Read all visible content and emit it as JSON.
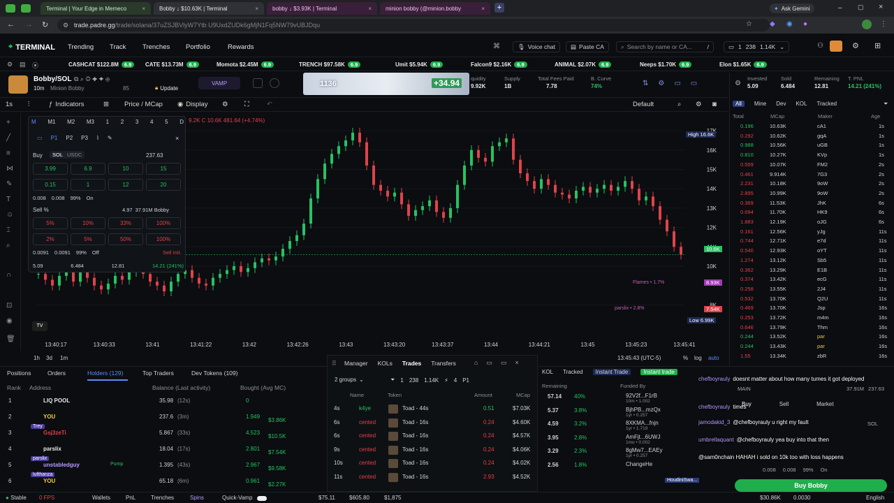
{
  "browser": {
    "tabs": [
      {
        "title": "Terminal | Your Edge in Memeco",
        "active": false
      },
      {
        "title": "Bobby ↓ $10.63K | Terminal",
        "active": true
      },
      {
        "title": "bobby ↓ $3.93K | Terminal",
        "active": false
      },
      {
        "title": "minion bobby (@minion.bobby",
        "active": false
      }
    ],
    "gemini": "Ask Gemini",
    "url_host": "trade.padre.gg",
    "url_path": "/trade/solana/37uZSJBVlyW7Ytb U9UxdZUDk6gMjN1Fq5NW79vUBJDqu"
  },
  "nav": {
    "logo": "TERMINAL",
    "links": [
      "Trending",
      "Track",
      "Trenches",
      "Portfolio",
      "Rewards"
    ],
    "voice_chat": "Voice chat",
    "paste_ca": "Paste CA",
    "search_placeholder": "Search by name or CA...",
    "search_shortcut": "/",
    "wallet_count": "1",
    "wallet_a": "238",
    "wallet_b": "1.14K"
  },
  "ticker": [
    {
      "name": "CASHCAT",
      "mc": "$122.8M",
      "pct": "6.9"
    },
    {
      "name": "CATE",
      "mc": "$13.73M",
      "pct": "6.9"
    },
    {
      "name": "Momota",
      "mc": "$2.45M",
      "pct": "6.9"
    },
    {
      "name": "TRENCH",
      "mc": "$97.58K",
      "pct": "6.9"
    },
    {
      "name": "Umit",
      "mc": "$5.94K",
      "pct": "6.9"
    },
    {
      "name": "Falcon9",
      "mc": "$2.16K",
      "pct": "6.9"
    },
    {
      "name": "ANIMAL",
      "mc": "$2.07K",
      "pct": "6.9"
    },
    {
      "name": "Neeps",
      "mc": "$1.70K",
      "pct": "6.9"
    },
    {
      "name": "Elon",
      "mc": "$1.65K",
      "pct": "6.9"
    }
  ],
  "token": {
    "pair": "Bobby/SOL",
    "name": "Minion Bobby",
    "age": "10m",
    "holders": "85",
    "update": "Update",
    "vamp": "VAMP",
    "banner_num": "1136",
    "banner_pnl": "+34.94",
    "liquidity_label": "quidity",
    "liquidity": "9.92K",
    "supply_label": "Supply",
    "supply": "1B",
    "fees_label": "Total Fees Paid",
    "fees": "7.78",
    "curve_label": "B. Curve",
    "curve": "74%"
  },
  "pnl": {
    "invested_label": "Invested",
    "invested": "5.09",
    "sold_label": "Sold",
    "sold": "6.484",
    "remaining_label": "Remaining",
    "remaining": "12.81",
    "tpnl_label": "T. PNL",
    "tpnl": "14.21 (241%)"
  },
  "chart_toolbar": {
    "interval": "1s",
    "indicators": "Indicators",
    "price_mcap": "Price / MCap",
    "display": "Display",
    "default": "Default"
  },
  "chart_data": {
    "type": "candlestick",
    "ohlc_text": "9.2K C 10.6K 481.64 (+4.74%)",
    "y_ticks": [
      "17K",
      "16K",
      "15K",
      "14K",
      "13K",
      "12K",
      "11K",
      "10K",
      "8K"
    ],
    "x_ticks": [
      "13:40:17",
      "13:40:33",
      "13:41",
      "13:41:22",
      "13:42",
      "13:42:26",
      "13:43",
      "13:43:20",
      "13:43:37",
      "13:44",
      "13:44:21",
      "13:45",
      "13:45:23",
      "13:45:41"
    ],
    "high_label": "High",
    "high": "16.6K",
    "current": "10.6K",
    "flag_a": "8.93K",
    "flag_b": "7.54K",
    "low_label": "Low",
    "low": "6.99K",
    "annot_a": "Flames • 1.7%",
    "annot_b": "parslix • 2.8%",
    "time_utc": "13:45:43 (UTC-5)",
    "scale_pct": "%",
    "scale_log": "log",
    "scale_auto": "auto",
    "ranges": [
      "1h",
      "3d",
      "1m"
    ],
    "series": [
      {
        "name": "mcap_k",
        "values": [
          9.6,
          9.3,
          9.0,
          9.5,
          9.7,
          9.2,
          9.8,
          9.4,
          9.0,
          8.8,
          9.1,
          9.5,
          9.3,
          9.7,
          9.9,
          9.6,
          9.2,
          9.0,
          8.7,
          9.2,
          9.6,
          9.8,
          9.4,
          9.1,
          9.0,
          9.4,
          9.6,
          9.8,
          10.0,
          9.7,
          9.9,
          10.2,
          10.4,
          10.3,
          10.5,
          10.9,
          11.3,
          11.6,
          12.2,
          13.5,
          14.5,
          15.3,
          15.8,
          16.2,
          16.5,
          16.9,
          16.4,
          15.2,
          14.2,
          13.9,
          13.6,
          13.8,
          13.2,
          12.6,
          12.9,
          13.1,
          13.4,
          12.8,
          12.5,
          13.0,
          14.2,
          15.2,
          16.0,
          15.6,
          15.4,
          16.2,
          16.4,
          16.6,
          15.5,
          14.8,
          14.4,
          14.0,
          14.5,
          14.2,
          13.8,
          13.7,
          13.5,
          13.9,
          14.1,
          13.8,
          14.0,
          14.2,
          13.9,
          14.1,
          14.4,
          14.0,
          13.4,
          13.6,
          13.1,
          12.4,
          11.8,
          11.0,
          10.6
        ]
      }
    ]
  },
  "buy_panel": {
    "presets": [
      "M",
      "M1",
      "M2",
      "M3",
      "1",
      "2",
      "3",
      "4",
      "5",
      "D"
    ],
    "tabs": [
      "P1",
      "P2",
      "P3"
    ],
    "buy_label": "Buy",
    "currency_sol": "SOL",
    "currency_usdc": "USDC",
    "balance": "237.63",
    "amounts_row1": [
      "3.99",
      "6.9",
      "10",
      "15"
    ],
    "amounts_row2": [
      "0.15",
      "1",
      "12",
      "20"
    ],
    "buy_fee1": "0.008",
    "buy_fee2": "0.008",
    "buy_slip": "99%",
    "buy_mev": "On",
    "sell_label": "Sell %",
    "sell_bal": "4.97",
    "sell_bal2": "37.91M Bobby",
    "sell_row1": [
      "5%",
      "10%",
      "33%",
      "100%"
    ],
    "sell_row2": [
      "2%",
      "5%",
      "50%",
      "100%"
    ],
    "sell_fee1": "0.0091",
    "sell_fee2": "0.0091",
    "sell_slip": "99%",
    "sell_mev": "Off",
    "sell_init": "Sell Init.",
    "foot": [
      "5.09",
      "6.484",
      "12.81",
      "14.21 (241%)"
    ]
  },
  "trades_panel": {
    "filters": [
      "All",
      "Mine",
      "Dev",
      "KOL",
      "Tracked"
    ],
    "headers": [
      "Total",
      "MCap",
      "Maker",
      "Age"
    ],
    "rows": [
      {
        "total": "0.196",
        "mc": "10.63K",
        "maker": "cA1",
        "age": "1s",
        "side": "buy"
      },
      {
        "total": "0.292",
        "mc": "10.62K",
        "maker": "gqA",
        "age": "1s",
        "side": "sell"
      },
      {
        "total": "0.988",
        "mc": "10.56K",
        "maker": "uGB",
        "age": "1s",
        "side": "buy"
      },
      {
        "total": "0.810",
        "mc": "10.27K",
        "maker": "KVp",
        "age": "1s",
        "side": "buy"
      },
      {
        "total": "0.559",
        "mc": "10.07K",
        "maker": "FM2",
        "age": "2s",
        "side": "sell"
      },
      {
        "total": "0.461",
        "mc": "9.914K",
        "maker": "7G3",
        "age": "2s",
        "side": "sell"
      },
      {
        "total": "2.231",
        "mc": "10.18K",
        "maker": "9oW",
        "age": "2s",
        "side": "sell"
      },
      {
        "total": "2.895",
        "mc": "10.99K",
        "maker": "9oW",
        "age": "2s",
        "side": "sell"
      },
      {
        "total": "0.369",
        "mc": "11.53K",
        "maker": "JhK",
        "age": "6s",
        "side": "sell"
      },
      {
        "total": "0.694",
        "mc": "11.70K",
        "maker": "HK9",
        "age": "6s",
        "side": "sell"
      },
      {
        "total": "1.883",
        "mc": "12.19K",
        "maker": "oJG",
        "age": "6s",
        "side": "sell"
      },
      {
        "total": "0.161",
        "mc": "12.56K",
        "maker": "yJg",
        "age": "11s",
        "side": "sell"
      },
      {
        "total": "0.744",
        "mc": "12.71K",
        "maker": "e7d",
        "age": "11s",
        "side": "sell"
      },
      {
        "total": "0.540",
        "mc": "12.93K",
        "maker": "oYT",
        "age": "11s",
        "side": "sell"
      },
      {
        "total": "1.274",
        "mc": "13.12K",
        "maker": "Sb5",
        "age": "11s",
        "side": "sell"
      },
      {
        "total": "0.362",
        "mc": "13.29K",
        "maker": "E1B",
        "age": "11s",
        "side": "sell"
      },
      {
        "total": "0.374",
        "mc": "13.42K",
        "maker": "ecG",
        "age": "11s",
        "side": "sell"
      },
      {
        "total": "0.258",
        "mc": "13.55K",
        "maker": "2J4",
        "age": "11s",
        "side": "sell"
      },
      {
        "total": "0.532",
        "mc": "13.70K",
        "maker": "Q2U",
        "age": "11s",
        "side": "sell"
      },
      {
        "total": "0.469",
        "mc": "13.70K",
        "maker": "Jsp",
        "age": "16s",
        "side": "sell"
      },
      {
        "total": "0.253",
        "mc": "13.72K",
        "maker": "m4m",
        "age": "16s",
        "side": "sell"
      },
      {
        "total": "0.646",
        "mc": "13.79K",
        "maker": "Thm",
        "age": "16s",
        "side": "sell"
      },
      {
        "total": "0.244",
        "mc": "13.52K",
        "maker": "par",
        "age": "16s",
        "side": "buy"
      },
      {
        "total": "0.244",
        "mc": "13.43K",
        "maker": "par",
        "age": "16s",
        "side": "buy"
      },
      {
        "total": "1.55",
        "mc": "13.34K",
        "maker": "zbR",
        "age": "16s",
        "side": "sell"
      }
    ]
  },
  "bottom_tabs": [
    "Positions",
    "Orders",
    "Holders (129)",
    "Top Traders",
    "Dev Tokens (109)"
  ],
  "holders": {
    "headers": [
      "Rank",
      "Address",
      "Balance (Last activity)",
      "Bought (Avg MC)"
    ],
    "rows": [
      {
        "rank": "1",
        "addr": "LIQ POOL",
        "bal": "35.98",
        "act": "(12s)",
        "bought": "0",
        "bought_mc": ""
      },
      {
        "rank": "2",
        "addr": "YOU",
        "bal": "237.6",
        "act": "(3m)",
        "bought": "1.949",
        "bought_mc": "$3.86K"
      },
      {
        "rank": "3",
        "addr": "Gsj3zeTi",
        "bal": "5.867",
        "act": "(33s)",
        "bought": "4.523",
        "bought_mc": "$10.5K"
      },
      {
        "rank": "4",
        "addr": "parslix",
        "bal": "18.04",
        "act": "(17s)",
        "bought": "2.801",
        "bought_mc": "$7.54K"
      },
      {
        "rank": "5",
        "addr": "unstabledguy",
        "bal": "1.395",
        "act": "(43s)",
        "bought": "2.967",
        "bought_mc": "$9.58K"
      },
      {
        "rank": "6",
        "addr": "YOU",
        "bal": "65.18",
        "act": "(6m)",
        "bought": "0.961",
        "bought_mc": "$2.27K"
      }
    ],
    "tags": [
      "Trey",
      "parslix",
      "lufthanza"
    ],
    "pump_tag": "Pump"
  },
  "mid_panel": {
    "tabs": [
      "Manager",
      "KOLs",
      "Trades",
      "Transfers"
    ],
    "groups": "2 groups",
    "wallets": "1",
    "w_a": "238",
    "w_b": "1.14K",
    "w_c": "4",
    "preset": "P1",
    "headers": [
      "Name",
      "Token",
      "Amount",
      "MCap"
    ],
    "rows": [
      {
        "age": "4s",
        "name": "k4ye",
        "token": "Toad - 44s",
        "amt": "0.51",
        "mc": "$7.03K",
        "side": "buy"
      },
      {
        "age": "6s",
        "name": "cented",
        "token": "Toad - 16s",
        "amt": "0.24",
        "mc": "$4.60K",
        "side": "sell"
      },
      {
        "age": "6s",
        "name": "cented",
        "token": "Toad - 16s",
        "amt": "0.24",
        "mc": "$4.57K",
        "side": "sell"
      },
      {
        "age": "9s",
        "name": "cented",
        "token": "Toad - 16s",
        "amt": "0.24",
        "mc": "$4.06K",
        "side": "sell"
      },
      {
        "age": "10s",
        "name": "cented",
        "token": "Toad - 16s",
        "amt": "0.24",
        "mc": "$4.02K",
        "side": "sell"
      },
      {
        "age": "11s",
        "name": "cented",
        "token": "Toad - 16s",
        "amt": "2.93",
        "mc": "$4.52K",
        "side": "sell"
      }
    ]
  },
  "remaining_panel": {
    "tabs": [
      "KOL",
      "Tracked",
      "Instant Trade",
      "Instant trade"
    ],
    "headers": [
      "Remaining",
      "Funded By"
    ],
    "rows": [
      {
        "rem": "57.14",
        "pct": "40%",
        "fund": "92V2f...F1rB",
        "sub": "10m • 1.002"
      },
      {
        "rem": "5.37",
        "pct": "3.8%",
        "fund": "BjhPB...mzQx",
        "sub": "1yr • 0.257"
      },
      {
        "rem": "4.59",
        "pct": "3.2%",
        "fund": "8XKMA...fnjn",
        "sub": "1yr • 1.719"
      },
      {
        "rem": "3.95",
        "pct": "2.8%",
        "fund": "AmFjt...6UWJ",
        "sub": "1mo • 0.002"
      },
      {
        "rem": "3.29",
        "pct": "2.3%",
        "fund": "8gMw7...EAEy",
        "sub": "1yr • 0.257"
      },
      {
        "rem": "2.56",
        "pct": "1.8%",
        "fund": "ChangeHe",
        "sub": ""
      }
    ],
    "houdini": "HoudiniSwa..."
  },
  "chat": [
    {
      "user": "chefboyrauly",
      "msg": "doesnt matter about how many tumes it got deployed"
    },
    {
      "user": "chefboyrauly",
      "msg": "times"
    },
    {
      "user": "jamodakid_3",
      "msg": "@chefboyrauly u right my fault"
    },
    {
      "user": "umbrellaquant",
      "msg": "@chefboyrauly yea buy into that then"
    },
    {
      "user": "",
      "msg": "@sam0nchain HAHAH i sold on 10k too with loss happens"
    }
  ],
  "overlay_trade": {
    "main": "MAIN",
    "main_bal": "37.91M",
    "main_bal2": "237.63",
    "tabs": [
      "Buy",
      "Sell",
      "Market"
    ],
    "sol": "SOL",
    "f1": "0.008",
    "f2": "0.008",
    "slip": "99%",
    "mev": "On",
    "buy_btn": "Buy Bobby"
  },
  "status": {
    "stable": "Stable",
    "fps": "0 FPS",
    "items": [
      "Wallets",
      "PnL",
      "Trenches",
      "Spins",
      "Quick-Vamp"
    ],
    "sol_price": "$75.11",
    "btc": "$605.80",
    "eth": "$1,875",
    "mc1": "$30.86K",
    "mc2": "0.0030",
    "lang": "English"
  }
}
